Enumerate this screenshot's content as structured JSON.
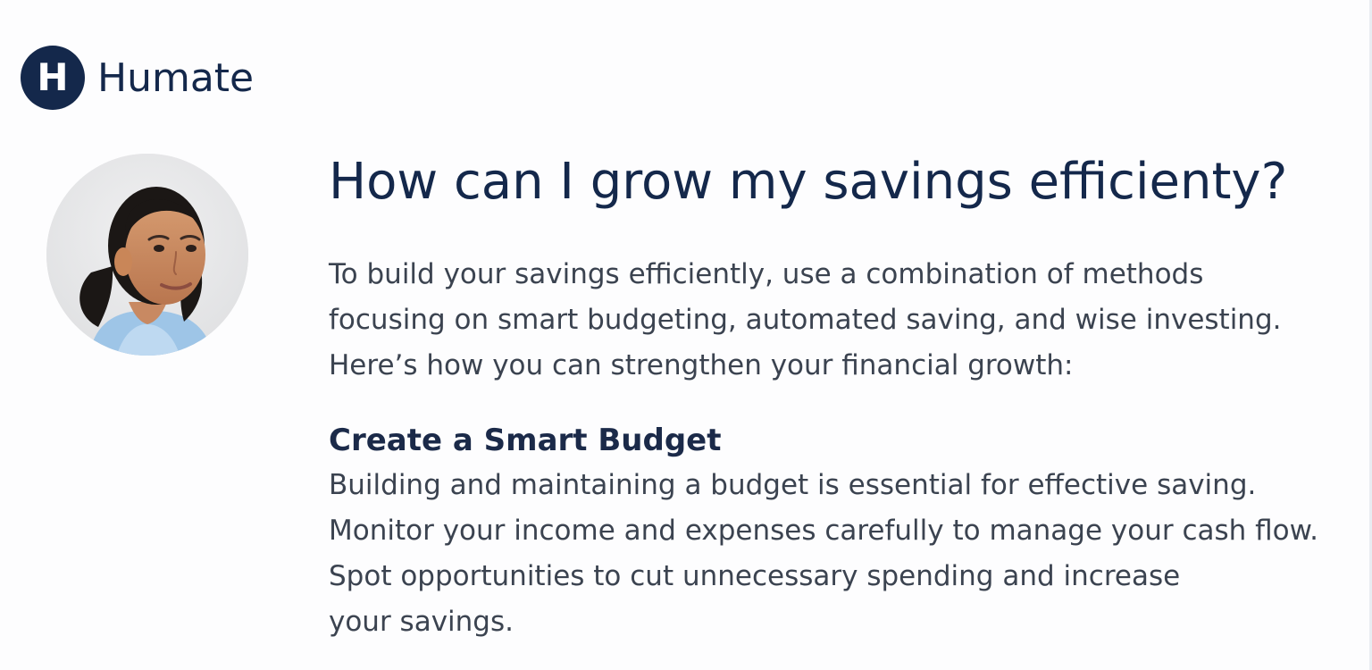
{
  "brand": {
    "mark_letter": "H",
    "name": "Humate",
    "color": "#14284b"
  },
  "avatar": {
    "alt": "User avatar",
    "bg_color": "#e9e9ea"
  },
  "question": {
    "title": "How can I grow my savings efficienty?"
  },
  "answer": {
    "intro_lines": [
      "To build your savings efficiently, use a combination of methods",
      "focusing on smart budgeting, automated saving, and wise investing.",
      "Here’s how you can strengthen your financial growth:"
    ],
    "sections": [
      {
        "title": "Create a Smart Budget",
        "lines": [
          "Building and maintaining a budget is essential for effective saving.",
          "Monitor your income and expenses carefully to manage your cash flow.",
          "Spot opportunities to cut unnecessary spending and increase",
          "your savings."
        ]
      }
    ]
  }
}
